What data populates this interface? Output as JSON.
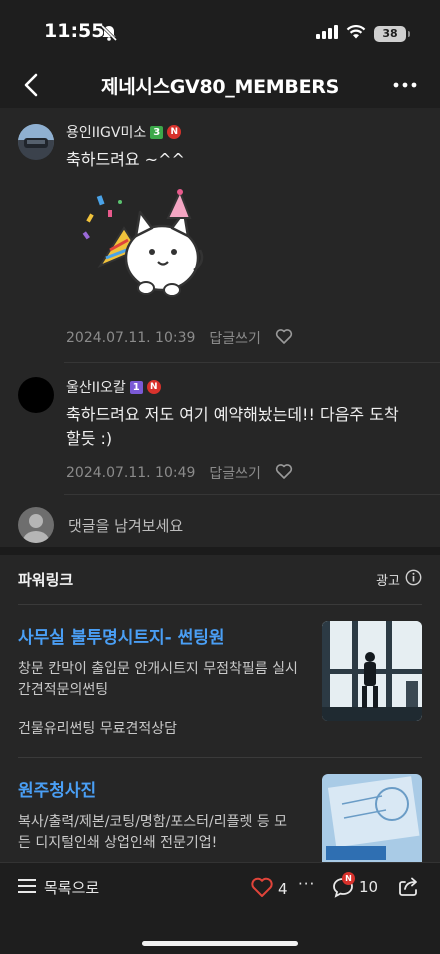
{
  "status": {
    "time": "11:55",
    "battery": "38"
  },
  "nav": {
    "title": "제네시스GV80_MEMBERS"
  },
  "comments": [
    {
      "author": "용인IIGV미소",
      "level": "3",
      "badge": "N",
      "text": "축하드려요 ~^^",
      "date": "2024.07.11. 10:39",
      "reply_label": "답글쓰기"
    },
    {
      "author": "울산II오칼",
      "level": "1",
      "badge": "N",
      "text": "축하드려요 저도 여기 예약해놨는데!! 다음주 도착 할듯 :)",
      "date": "2024.07.11. 10:49",
      "reply_label": "답글쓰기"
    }
  ],
  "reply_input": {
    "placeholder": "댓글을 남겨보세요"
  },
  "powerlink": {
    "title": "파워링크",
    "ad_label": "광고",
    "ads": [
      {
        "title": "사무실 불투명시트지- 썬팅원",
        "desc": "창문 칸막이 출입문 안개시트지 무점착필름 실시간견적문의썬팅",
        "desc2": "건물유리썬팅 무료견적상담"
      },
      {
        "title": "원주청사진",
        "desc": "복사/출력/제본/코팅/명함/포스터/리플렛 등 모든 디지털인쇄 상업인쇄 전문기업!"
      }
    ]
  },
  "bottom": {
    "list_label": "목록으로",
    "like_count": "4",
    "comment_count": "10",
    "comment_badge": "N"
  },
  "colors": {
    "background": "#1e1e1e",
    "content_bg": "#262626",
    "ad_title": "#4a9ff5",
    "like_heart": "#e0443a",
    "badge_red": "#d8322c",
    "level3_green": "#3ca84a",
    "level1_purple": "#7b5ad6"
  }
}
